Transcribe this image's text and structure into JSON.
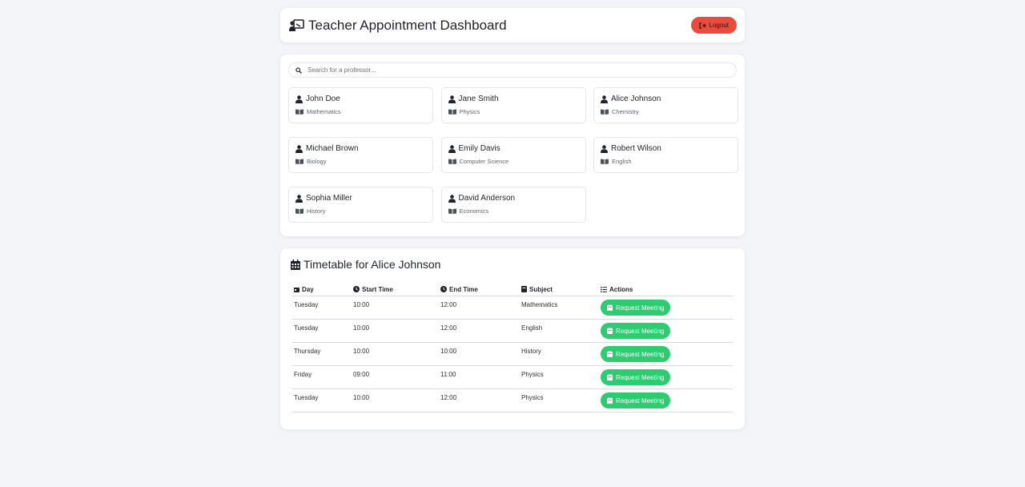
{
  "header": {
    "title": "Teacher Appointment Dashboard",
    "logout_label": "Logout"
  },
  "search": {
    "placeholder": "Search for a professor..."
  },
  "professors": [
    {
      "name": "John Doe",
      "subject": "Mathematics"
    },
    {
      "name": "Jane Smith",
      "subject": "Physics"
    },
    {
      "name": "Alice Johnson",
      "subject": "Chemistry"
    },
    {
      "name": "Michael Brown",
      "subject": "Biology"
    },
    {
      "name": "Emily Davis",
      "subject": "Computer Science"
    },
    {
      "name": "Robert Wilson",
      "subject": "English"
    },
    {
      "name": "Sophia Miller",
      "subject": "History"
    },
    {
      "name": "David Anderson",
      "subject": "Economics"
    }
  ],
  "timetable": {
    "title": "Timetable for Alice Johnson",
    "columns": [
      "Day",
      "Start Time",
      "End Time",
      "Subject",
      "Actions"
    ],
    "rows": [
      {
        "day": "Tuesday",
        "start": "10:00",
        "end": "12:00",
        "subject": "Mathematics",
        "action": "Request Meeting"
      },
      {
        "day": "Tuesday",
        "start": "10:00",
        "end": "12:00",
        "subject": "English",
        "action": "Request Meeting"
      },
      {
        "day": "Thursday",
        "start": "10:00",
        "end": "10:00",
        "subject": "History",
        "action": "Request Meeting"
      },
      {
        "day": "Friday",
        "start": "09:00",
        "end": "11:00",
        "subject": "Physics",
        "action": "Request Meeting"
      },
      {
        "day": "Tuesday",
        "start": "10:00",
        "end": "12:00",
        "subject": "Physics",
        "action": "Request Meeting"
      }
    ]
  },
  "colors": {
    "logout": "#e74c3c",
    "request": "#2ecc71",
    "background": "#f4f5f9"
  }
}
